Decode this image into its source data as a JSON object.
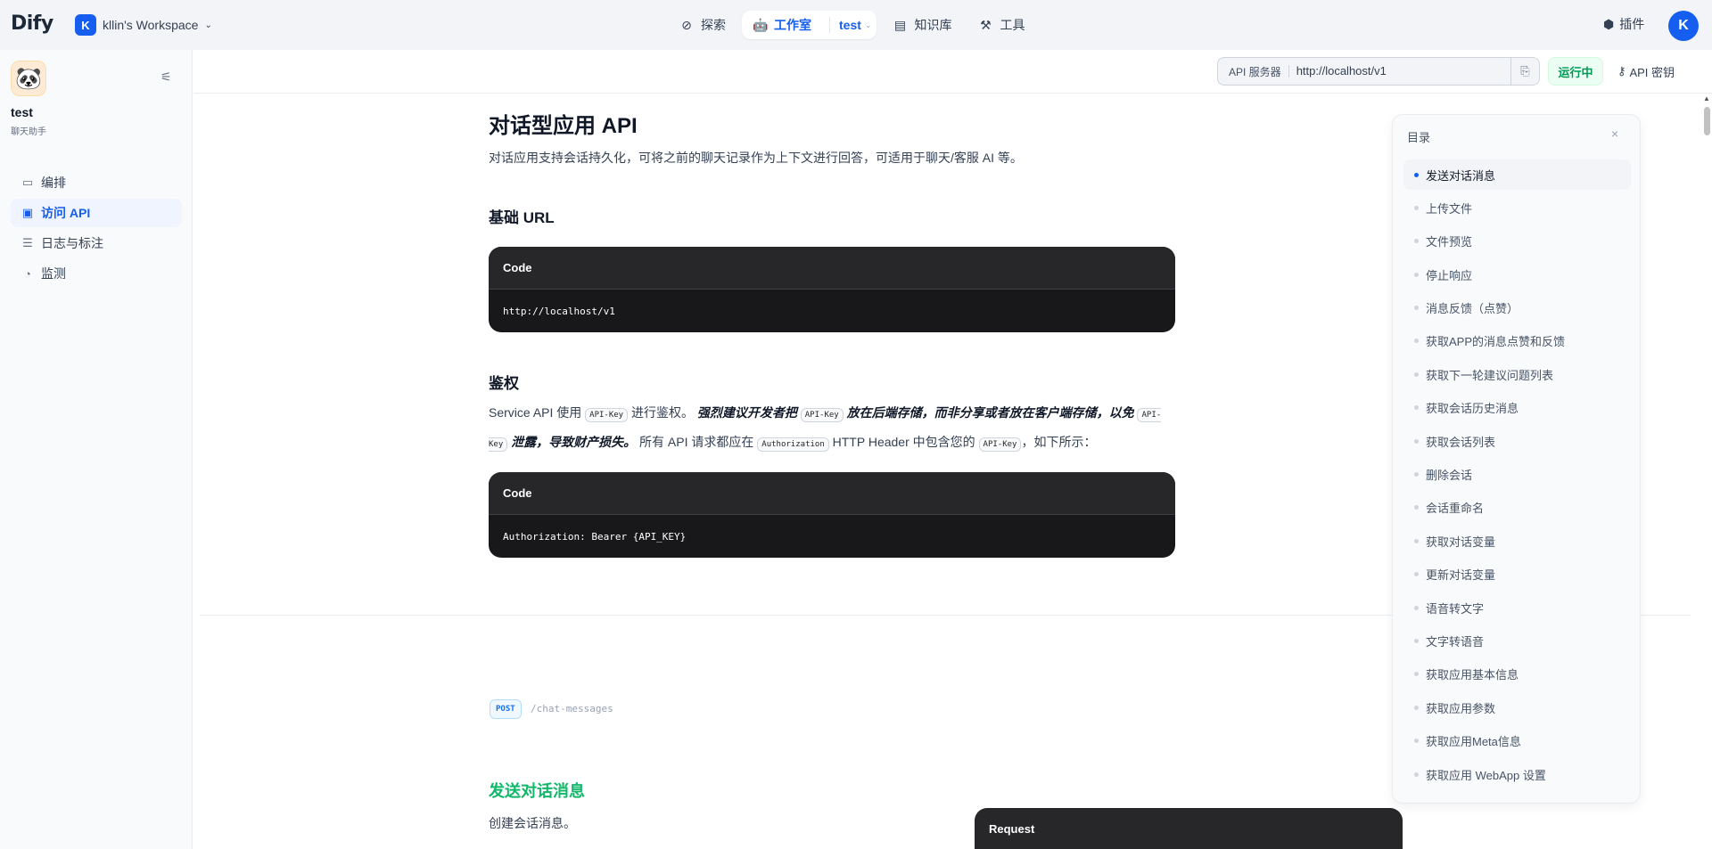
{
  "topbar": {
    "logo": "Dify",
    "workspace": {
      "initial": "K",
      "name": "kllin's Workspace"
    },
    "nav": [
      {
        "label": "探索",
        "icon": "compass-icon"
      },
      {
        "label": "工作室",
        "icon": "robot-icon",
        "app": "test"
      },
      {
        "label": "知识库",
        "icon": "book-icon"
      },
      {
        "label": "工具",
        "icon": "hammer-icon"
      }
    ],
    "plugin_label": "插件",
    "user_initial": "K"
  },
  "sidebar": {
    "app_name": "test",
    "app_type": "聊天助手",
    "items": [
      {
        "label": "编排",
        "icon": "layout-icon",
        "active": false
      },
      {
        "label": "访问 API",
        "icon": "terminal-icon",
        "active": true
      },
      {
        "label": "日志与标注",
        "icon": "file-list-icon",
        "active": false
      },
      {
        "label": "监测",
        "icon": "dashboard-icon",
        "active": false
      }
    ]
  },
  "header": {
    "api_server_label": "API 服务器",
    "api_server_url": "http://localhost/v1",
    "status": "运行中",
    "api_key_label": "API 密钥"
  },
  "doc": {
    "title": "对话型应用 API",
    "lead": "对话应用支持会话持久化，可将之前的聊天记录作为上下文进行回答，可适用于聊天/客服 AI 等。",
    "base_url_heading": "基础 URL",
    "code1": {
      "title": "Code",
      "body": "http://localhost/v1"
    },
    "auth_heading": "鉴权",
    "auth_text": {
      "p1": "Service API 使用",
      "c1": "API-Key",
      "p2": "进行鉴权。",
      "s1": "强烈建议开发者把",
      "c2": "API-Key",
      "s2": "放在后端存储，而非分享或者放在客户端存储，以免",
      "c3": "API-Key",
      "s3": "泄露，导致财产损失。",
      "p3": "所有 API 请求都应在",
      "c4": "Authorization",
      "p4": "HTTP Header 中包含您的",
      "c5": "API-Key",
      "p5": "，如下所示："
    },
    "code2": {
      "title": "Code",
      "body": "Authorization: Bearer {API_KEY}"
    },
    "method": "POST",
    "endpoint": "/chat-messages",
    "section_title": "发送对话消息",
    "section_desc": "创建会话消息。",
    "request_label": "Request"
  },
  "toc": {
    "title": "目录",
    "items": [
      "发送对话消息",
      "上传文件",
      "文件预览",
      "停止响应",
      "消息反馈（点赞）",
      "获取APP的消息点赞和反馈",
      "获取下一轮建议问题列表",
      "获取会话历史消息",
      "获取会话列表",
      "删除会话",
      "会话重命名",
      "获取对话变量",
      "更新对话变量",
      "语音转文字",
      "文字转语音",
      "获取应用基本信息",
      "获取应用参数",
      "获取应用Meta信息",
      "获取应用 WebApp 设置"
    ],
    "active_index": 0
  }
}
